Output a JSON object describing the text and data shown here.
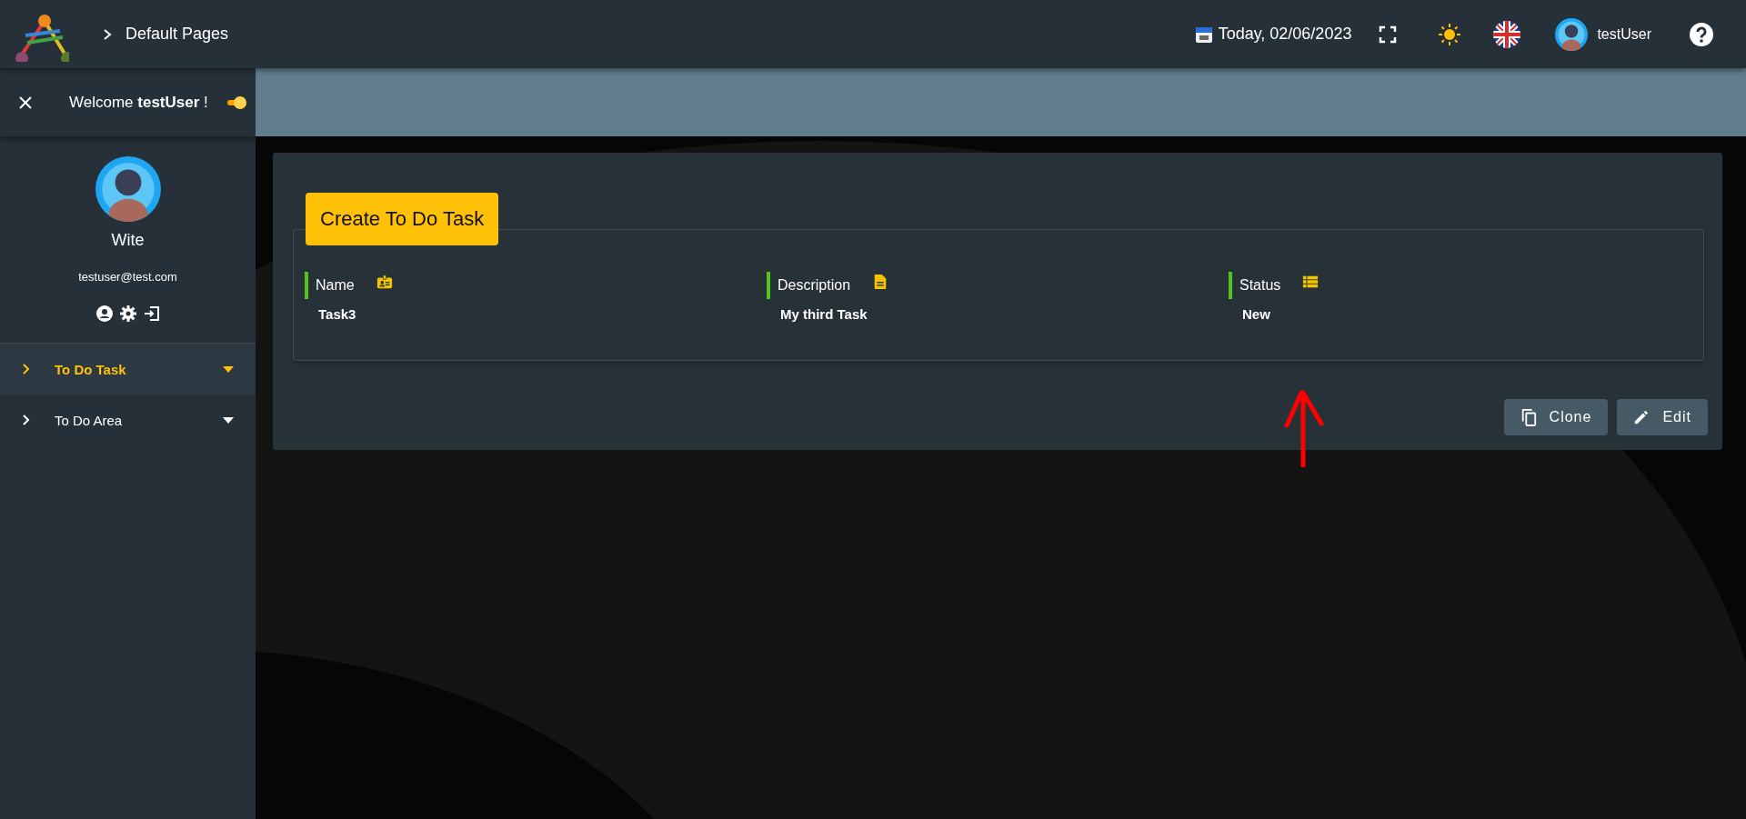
{
  "header": {
    "breadcrumb": "Default Pages",
    "date": "Today, 02/06/2023",
    "user": "testUser"
  },
  "sidebar": {
    "welcome": "Welcome **testUser** !",
    "toggle_on": true,
    "profile_name": "Wite",
    "email": "testuser@test.com",
    "menu": [
      {
        "label": "To Do Task",
        "selected": true
      },
      {
        "label": "To Do Area",
        "selected": false
      }
    ]
  },
  "task": {
    "create_button": "Create To Do Task",
    "fields": [
      {
        "kind": "name",
        "label": "Name",
        "value": "Task3"
      },
      {
        "kind": "description",
        "label": "Description",
        "value": "My third Task"
      },
      {
        "kind": "status",
        "label": "Status",
        "value": "New"
      }
    ],
    "actions": [
      {
        "kind": "clone",
        "label": "Clone"
      },
      {
        "kind": "edit",
        "label": "Edit"
      }
    ]
  }
}
